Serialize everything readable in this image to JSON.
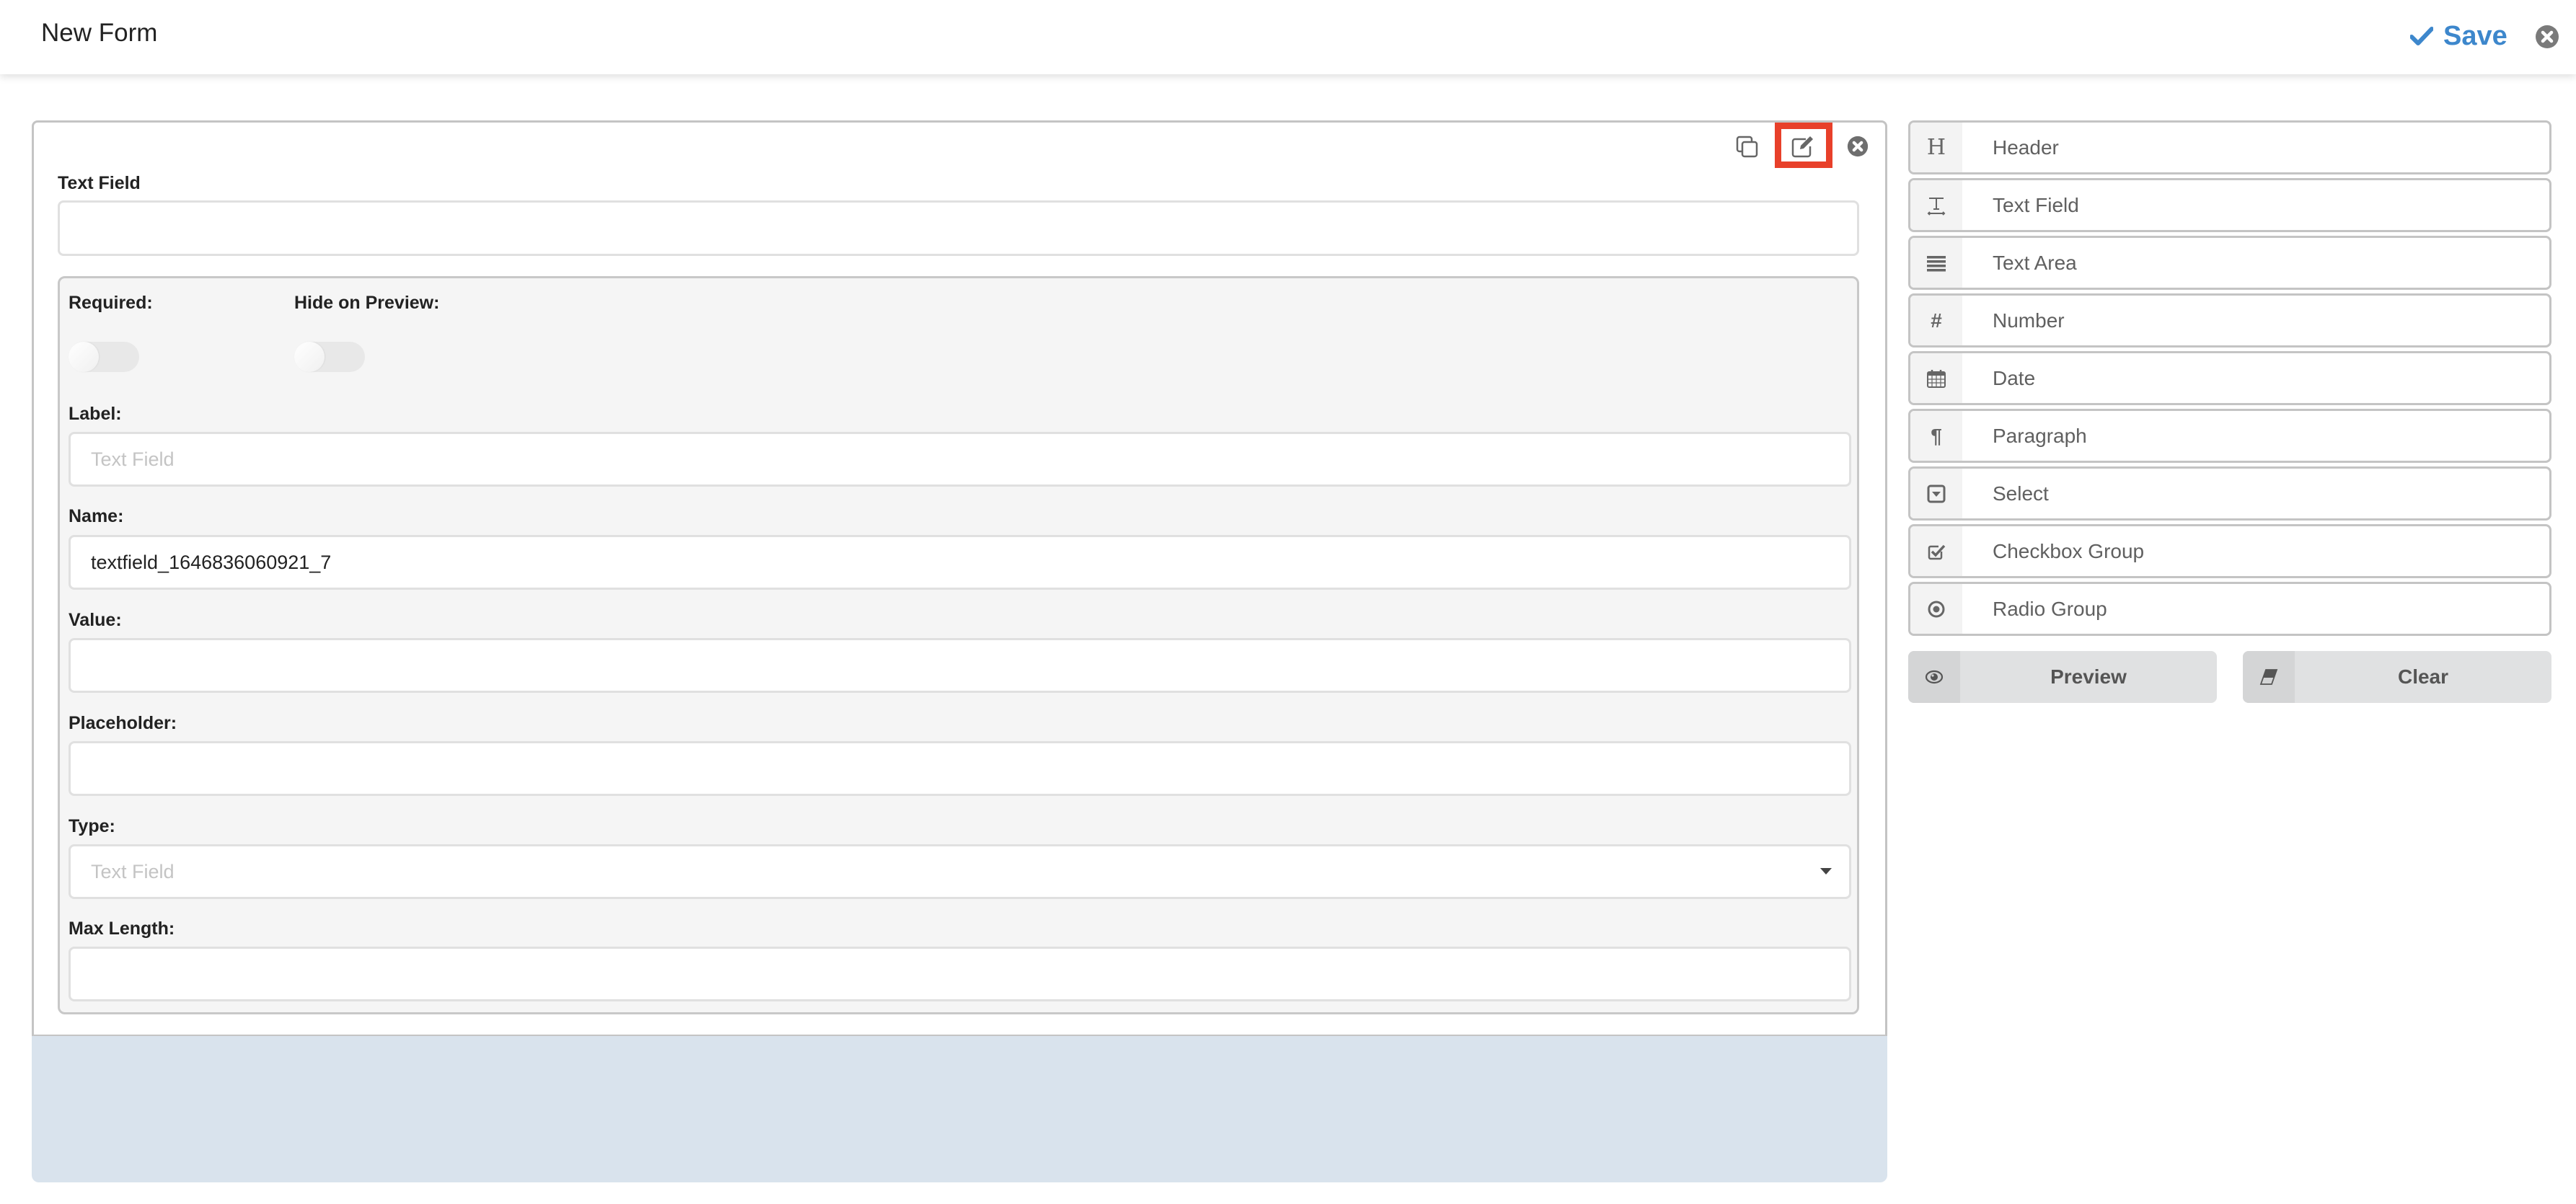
{
  "header": {
    "title": "New Form",
    "save_label": "Save",
    "save_color": "#3d87cc"
  },
  "card": {
    "actions": [
      {
        "name": "copy-icon",
        "label": "Duplicate"
      },
      {
        "name": "edit-icon",
        "label": "Edit",
        "highlighted": true
      },
      {
        "name": "remove-icon",
        "label": "Remove"
      }
    ],
    "field_label": "Text Field",
    "field_value": ""
  },
  "editor": {
    "required_label": "Required:",
    "required_on": false,
    "hide_label": "Hide on Preview:",
    "hide_on": false,
    "label_label": "Label:",
    "label_placeholder": "Text Field",
    "label_value": "",
    "name_label": "Name:",
    "name_value": "textfield_1646836060921_7",
    "value_label": "Value:",
    "value_value": "",
    "placeholder_label": "Placeholder:",
    "placeholder_value": "",
    "type_label": "Type:",
    "type_value": "Text Field",
    "maxlength_label": "Max Length:",
    "maxlength_value": ""
  },
  "toolbox": {
    "items": [
      {
        "label": "Header",
        "icon": "header-icon"
      },
      {
        "label": "Text Field",
        "icon": "text-field-icon"
      },
      {
        "label": "Text Area",
        "icon": "text-area-icon"
      },
      {
        "label": "Number",
        "icon": "number-icon"
      },
      {
        "label": "Date",
        "icon": "calendar-icon"
      },
      {
        "label": "Paragraph",
        "icon": "paragraph-icon"
      },
      {
        "label": "Select",
        "icon": "select-icon"
      },
      {
        "label": "Checkbox Group",
        "icon": "checkbox-icon"
      },
      {
        "label": "Radio Group",
        "icon": "radio-icon"
      }
    ],
    "preview_label": "Preview",
    "clear_label": "Clear"
  },
  "colors": {
    "highlight": "#e8402a",
    "dropzone": "#d9e3ed"
  }
}
